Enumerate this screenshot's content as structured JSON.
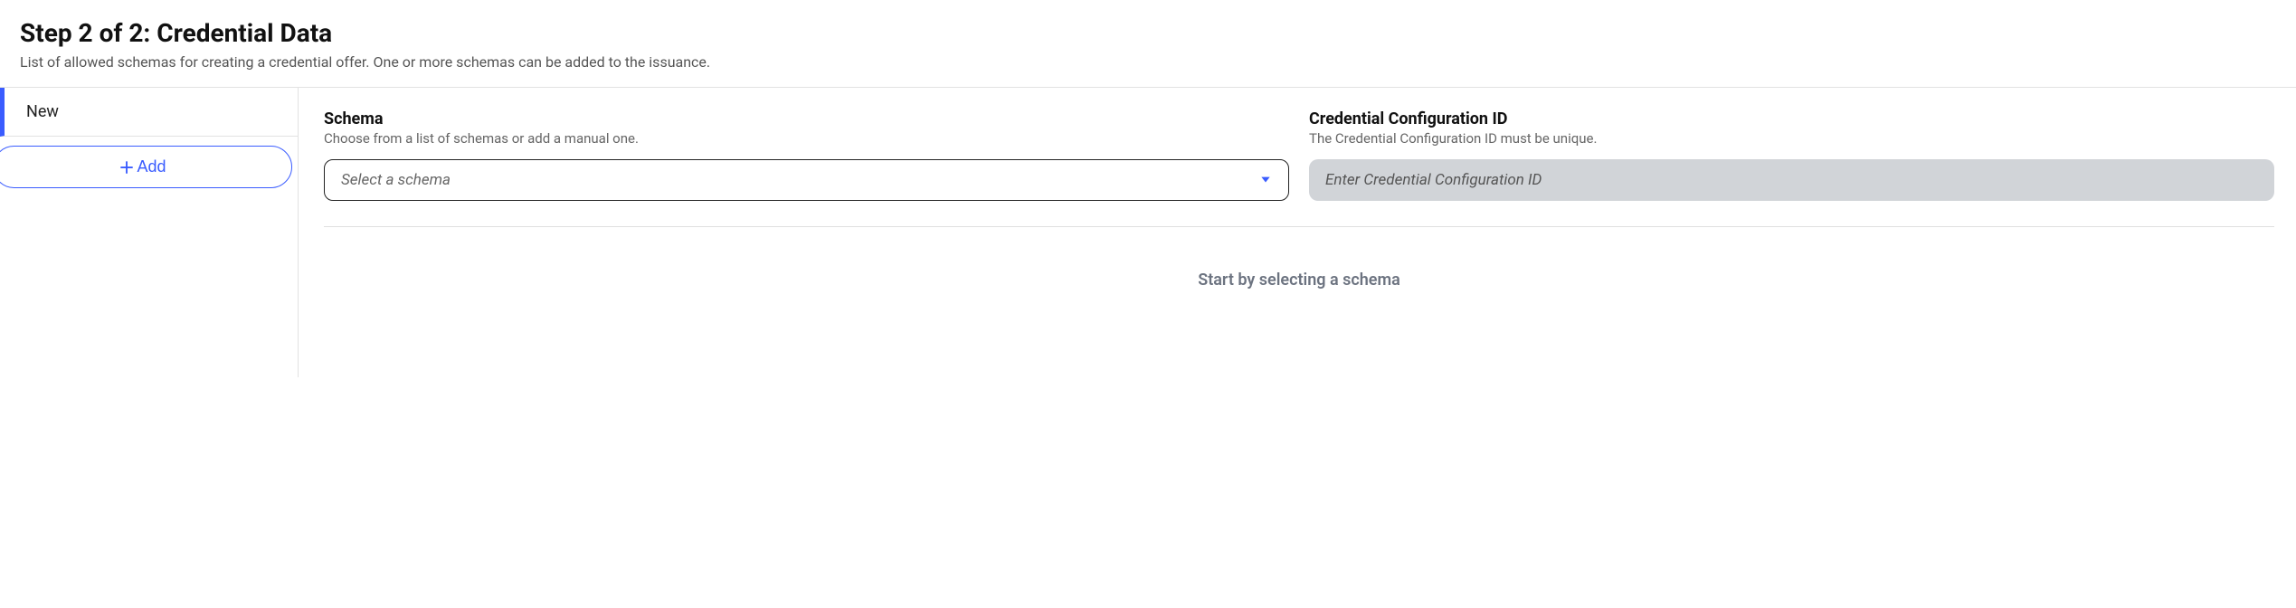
{
  "header": {
    "title": "Step 2 of 2: Credential Data",
    "subtitle": "List of allowed schemas for creating a credential offer. One or more schemas can be added to the issuance."
  },
  "sidebar": {
    "tab_label": "New",
    "add_button_label": "Add"
  },
  "schema_field": {
    "label": "Schema",
    "desc": "Choose from a list of schemas or add a manual one.",
    "placeholder": "Select a schema"
  },
  "config_id_field": {
    "label": "Credential Configuration ID",
    "desc": "The Credential Configuration ID must be unique.",
    "placeholder": "Enter Credential Configuration ID"
  },
  "empty_state": "Start by selecting a schema"
}
